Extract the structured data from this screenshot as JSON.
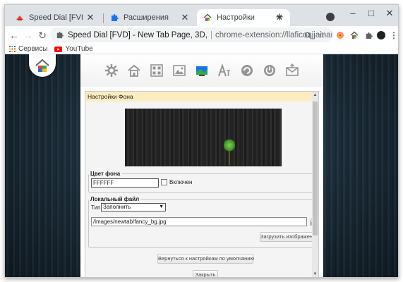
{
  "tabs": [
    {
      "label": "Speed Dial [FVD] - New Tab",
      "icon": "speed-dial-icon"
    },
    {
      "label": "Расширения",
      "icon": "puzzle-icon"
    },
    {
      "label": "Настройки",
      "icon": "fvd-house-icon"
    }
  ],
  "window_controls": {
    "minimize": "–",
    "maximize": "□",
    "close": "✕"
  },
  "toolbar": {
    "site": "Speed Dial [FVD] - New Tab Page, 3D,",
    "separator": "|",
    "url": "chrome-extension://llaficoajjainaijghjlofdf..."
  },
  "bookmarks": [
    {
      "label": "Сервисы",
      "icon": "apps-grid-icon"
    },
    {
      "label": "YouTube",
      "icon": "youtube-icon"
    }
  ],
  "dialog": {
    "title": "Настройки Фона",
    "color_group_legend": "Цвет фона",
    "color_value": "FFFFFF",
    "enabled_label": "Включен",
    "local_file_legend": "Локальный файл",
    "type_label": "Тип:",
    "type_value": "Заполнить",
    "path_value": "/images/newtab/fancy_bg.jpg",
    "upload_label": "Загрузить изображение",
    "reset_label": "Вернуться к настройкам по умолчанию",
    "close_label": "Закрыть"
  },
  "colors": {
    "title_bar_bg": "#fbedc0",
    "tab_strip": "#dee1e6",
    "page_bg": "#1d2d3a"
  }
}
